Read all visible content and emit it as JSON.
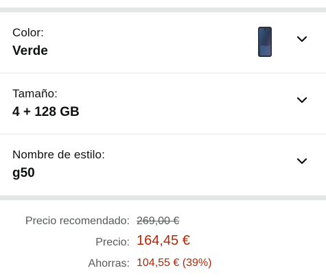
{
  "variations": [
    {
      "label": "Color:",
      "value": "Verde",
      "has_thumbnail": true,
      "thumbnail_icon": "phone-thumbnail"
    },
    {
      "label": "Tamaño:",
      "value": "4 + 128 GB",
      "has_thumbnail": false
    },
    {
      "label": "Nombre de estilo:",
      "value": "g50",
      "has_thumbnail": false
    }
  ],
  "pricing": {
    "list_price_label": "Precio recomendado:",
    "list_price_value": "269,00 €",
    "price_label": "Precio:",
    "price_value": "164,45 €",
    "savings_label": "Ahorras:",
    "savings_value": "104,55 € (39%)"
  },
  "colors": {
    "price_red": "#b12704",
    "muted_text": "#565959",
    "divider": "#e3e6e6"
  },
  "icons": {
    "expand": "chevron-down-icon"
  }
}
